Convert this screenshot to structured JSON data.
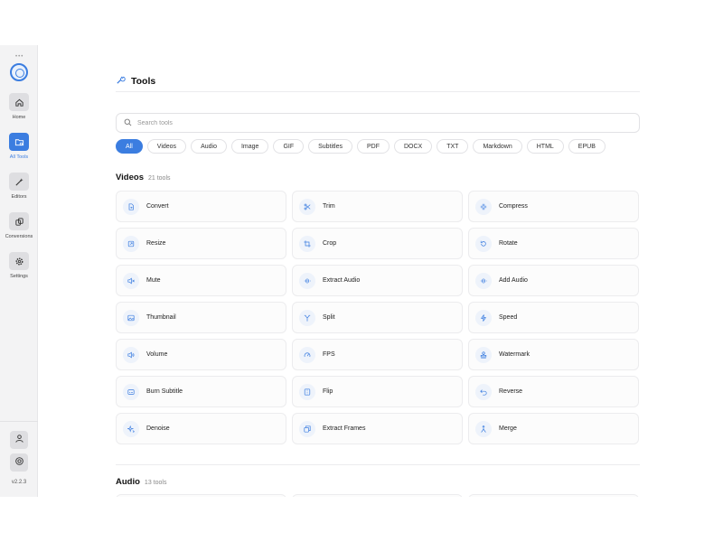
{
  "app": {
    "version": "v2.2.3"
  },
  "sidebar": {
    "items": [
      {
        "label": "Home",
        "icon": "home-icon"
      },
      {
        "label": "All Tools",
        "icon": "folder-icon"
      },
      {
        "label": "Editors",
        "icon": "wand-icon"
      },
      {
        "label": "Conversions",
        "icon": "copy-icon"
      },
      {
        "label": "Settings",
        "icon": "gear-icon"
      }
    ],
    "active": "All Tools",
    "bottom": [
      {
        "icon": "user-icon"
      },
      {
        "icon": "help-icon"
      }
    ]
  },
  "header": {
    "title": "Tools",
    "icon": "wrench-icon"
  },
  "search": {
    "placeholder": "Search tools",
    "value": ""
  },
  "filters": [
    "All",
    "Videos",
    "Audio",
    "Image",
    "GIF",
    "Subtitles",
    "PDF",
    "DOCX",
    "TXT",
    "Markdown",
    "HTML",
    "EPUB"
  ],
  "active_filter": "All",
  "sections": [
    {
      "name": "Videos",
      "count": "21 tools",
      "tools": [
        {
          "label": "Convert",
          "icon": "convert-icon"
        },
        {
          "label": "Trim",
          "icon": "scissors-icon"
        },
        {
          "label": "Compress",
          "icon": "compress-icon"
        },
        {
          "label": "Resize",
          "icon": "resize-icon"
        },
        {
          "label": "Crop",
          "icon": "crop-icon"
        },
        {
          "label": "Rotate",
          "icon": "rotate-icon"
        },
        {
          "label": "Mute",
          "icon": "mute-icon"
        },
        {
          "label": "Extract Audio",
          "icon": "waveform-icon"
        },
        {
          "label": "Add Audio",
          "icon": "waveform-icon"
        },
        {
          "label": "Thumbnail",
          "icon": "image-icon"
        },
        {
          "label": "Split",
          "icon": "split-icon"
        },
        {
          "label": "Speed",
          "icon": "speed-icon"
        },
        {
          "label": "Volume",
          "icon": "volume-icon"
        },
        {
          "label": "FPS",
          "icon": "gauge-icon"
        },
        {
          "label": "Watermark",
          "icon": "stamp-icon"
        },
        {
          "label": "Burn Subtitle",
          "icon": "subtitle-icon"
        },
        {
          "label": "Flip",
          "icon": "flip-icon"
        },
        {
          "label": "Reverse",
          "icon": "reverse-icon"
        },
        {
          "label": "Denoise",
          "icon": "sparkle-icon"
        },
        {
          "label": "Extract Frames",
          "icon": "frames-icon"
        },
        {
          "label": "Merge",
          "icon": "merge-icon"
        }
      ]
    },
    {
      "name": "Audio",
      "count": "13 tools"
    }
  ],
  "colors": {
    "accent": "#3b7de0",
    "traffic_yellow": "#f2a521",
    "traffic_green": "#3fba6e",
    "traffic_red": "#e8483f"
  }
}
